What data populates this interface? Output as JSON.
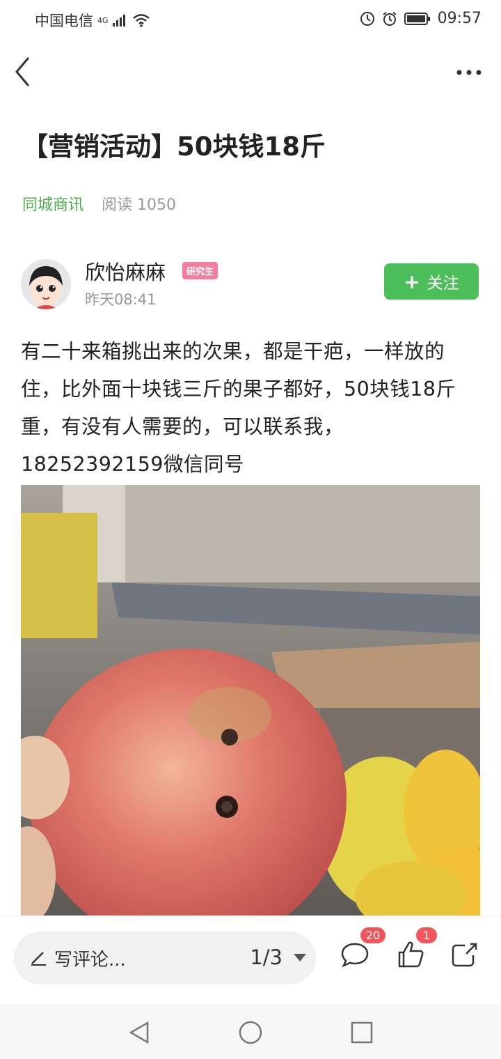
{
  "status": {
    "carrier": "中国电信",
    "network": "4G",
    "time": "09:57"
  },
  "nav": {
    "back_icon": "chevron-left-icon",
    "more_icon": "more-horizontal-icon"
  },
  "article": {
    "title": "【营销活动】50块钱18斤",
    "source": "同城商讯",
    "reads": "阅读 1050",
    "content": "有二十来箱挑出来的次果，都是干疤，一样放的住，比外面十块钱三斤的果子都好，50块钱18斤重，有没有人需要的，可以联系我，18252392159微信同号"
  },
  "author": {
    "name": "欣怡麻麻",
    "badge": "研究生",
    "time": "昨天08:41",
    "follow_plus": "+",
    "follow_label": "关注"
  },
  "bottom": {
    "comment_placeholder": "写评论...",
    "page_indicator": "1/3",
    "comment_count": "20",
    "like_count": "1"
  },
  "colors": {
    "accent_green": "#4cbe5a",
    "source_green": "#4cae4c",
    "badge_pink": "#f37ea0",
    "count_red": "#f2555a"
  }
}
